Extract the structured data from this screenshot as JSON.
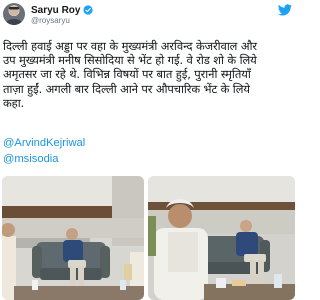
{
  "author": {
    "name": "Saryu Roy",
    "handle": "@roysaryu"
  },
  "icons": {
    "verified": "verified-badge-icon",
    "platform": "twitter-bird-icon"
  },
  "tweet": {
    "lines": [
      "दिल्ली हवाई अड्डा पर वहा के मुख्यमंत्री अरविन्द केजरीवाल और",
      "उप मुख्यमंत्री मनीष सिसोदिया से भेंट हो गई. वे रोड शो के लिये",
      "अमृतसर जा रहे थे. विभिन्न विषयों पर बात हुई, पुरानी स्मृतियाँ",
      "ताज़ा हुईं. अगली बार दिल्ली आने पर औपचारिक भेंट के लिये",
      "कहा."
    ],
    "mentions": [
      "@ArvindKejriwal",
      "@msisodia"
    ]
  },
  "colors": {
    "link": "#1b95e0",
    "verified": "#1da1f2"
  }
}
